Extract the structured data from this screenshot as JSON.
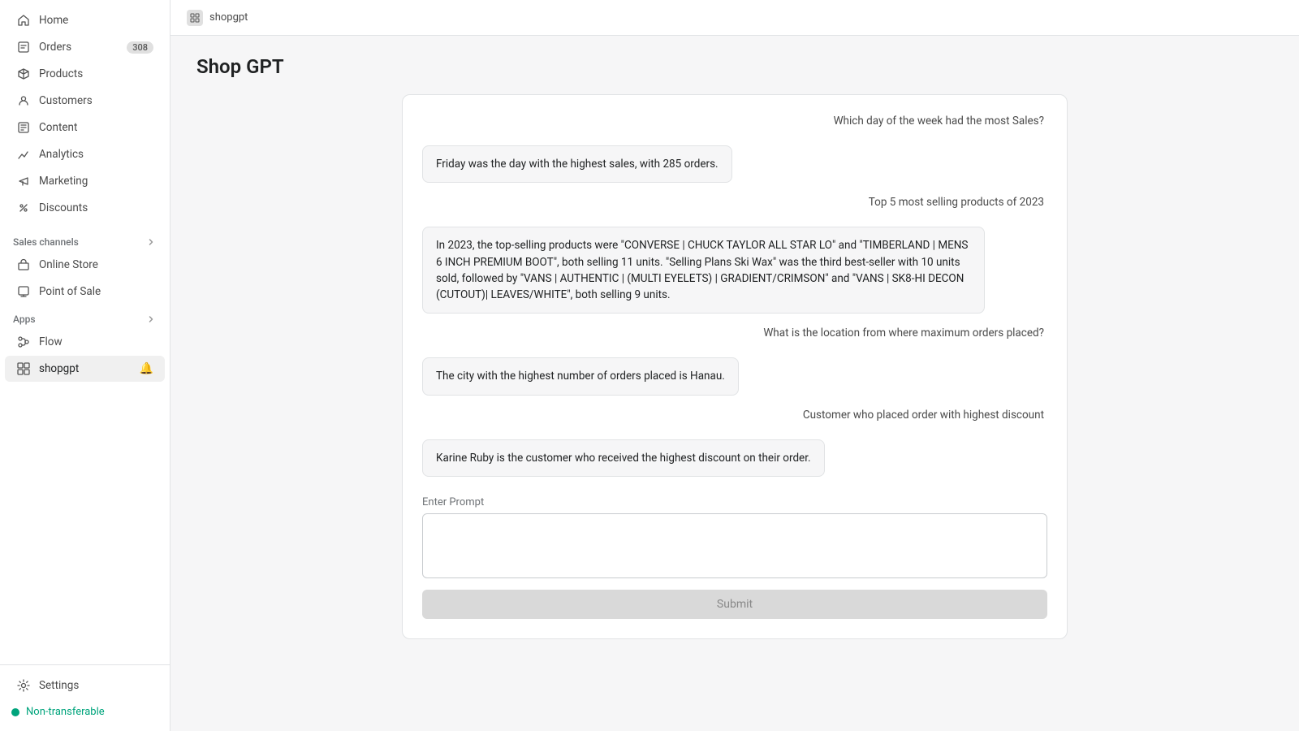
{
  "sidebar": {
    "nav_items": [
      {
        "id": "home",
        "label": "Home",
        "icon": "home-icon"
      },
      {
        "id": "orders",
        "label": "Orders",
        "icon": "orders-icon",
        "badge": "308"
      },
      {
        "id": "products",
        "label": "Products",
        "icon": "products-icon"
      },
      {
        "id": "customers",
        "label": "Customers",
        "icon": "customers-icon"
      },
      {
        "id": "content",
        "label": "Content",
        "icon": "content-icon"
      },
      {
        "id": "analytics",
        "label": "Analytics",
        "icon": "analytics-icon"
      },
      {
        "id": "marketing",
        "label": "Marketing",
        "icon": "marketing-icon"
      },
      {
        "id": "discounts",
        "label": "Discounts",
        "icon": "discounts-icon"
      }
    ],
    "sales_channels_label": "Sales channels",
    "sales_channels": [
      {
        "id": "online-store",
        "label": "Online Store",
        "icon": "online-store-icon"
      },
      {
        "id": "point-of-sale",
        "label": "Point of Sale",
        "icon": "pos-icon"
      }
    ],
    "apps_label": "Apps",
    "apps": [
      {
        "id": "flow",
        "label": "Flow",
        "icon": "flow-icon"
      }
    ],
    "shopgpt_label": "shopgpt",
    "settings_label": "Settings",
    "non_transferable_label": "Non-transferable"
  },
  "topbar": {
    "app_name": "shopgpt"
  },
  "main": {
    "page_title": "Shop GPT",
    "prompt_label": "Enter Prompt",
    "submit_label": "Submit",
    "conversations": [
      {
        "question": "Which day of the week had the most Sales?",
        "answer": "Friday was the day with the highest sales, with 285 orders."
      },
      {
        "question": "Top 5 most selling products of 2023",
        "answer": "In 2023, the top-selling products were \"CONVERSE | CHUCK TAYLOR ALL STAR LO\" and \"TIMBERLAND | MENS 6 INCH PREMIUM BOOT\", both selling 11 units. \"Selling Plans Ski Wax\" was the third best-seller with 10 units sold, followed by \"VANS | AUTHENTIC | (MULTI EYELETS) | GRADIENT/CRIMSON\" and \"VANS | SK8-HI DECON (CUTOUT)| LEAVES/WHITE\", both selling 9 units."
      },
      {
        "question": "What is the location from where maximum orders placed?",
        "answer": "The city with the highest number of orders placed is Hanau."
      },
      {
        "question": "Customer who placed order with highest discount",
        "answer": "Karine Ruby is the customer who received the highest discount on their order."
      }
    ]
  }
}
